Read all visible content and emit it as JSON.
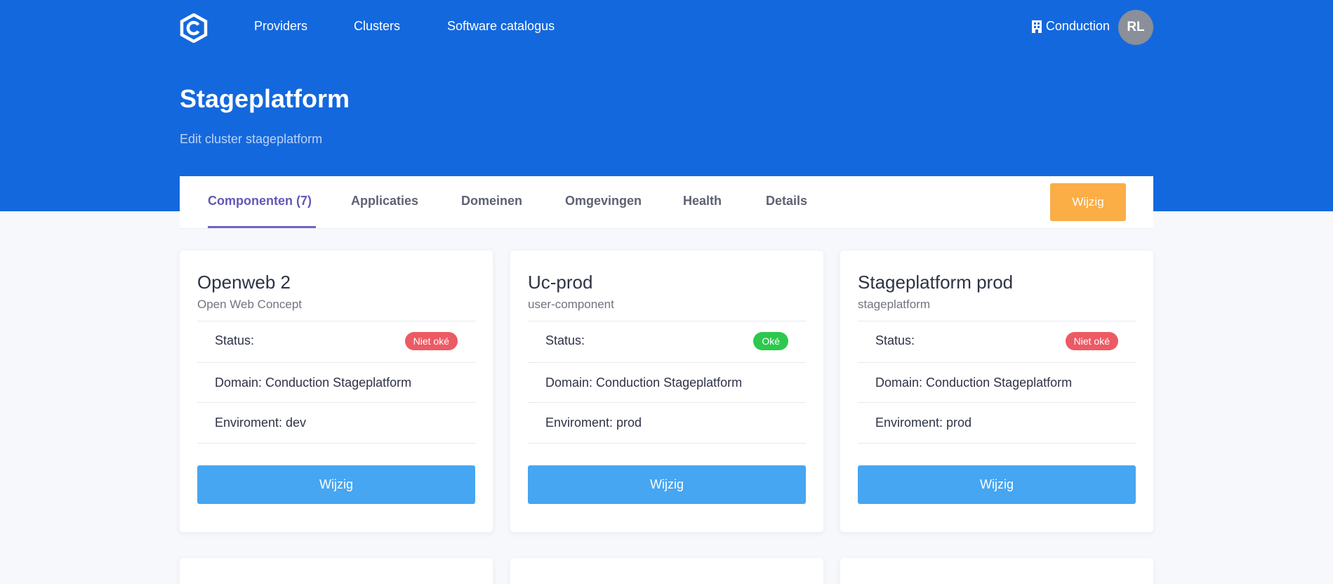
{
  "nav": {
    "links": [
      "Providers",
      "Clusters",
      "Software catalogus"
    ],
    "organization": "Conduction",
    "avatar_initials": "RL"
  },
  "header": {
    "title": "Stageplatform",
    "subtitle": "Edit cluster stageplatform"
  },
  "tabs": [
    "Componenten  (7)",
    "Applicaties",
    "Domeinen",
    "Omgevingen",
    "Health",
    "Details"
  ],
  "edit_button": "Wijzig",
  "cards": [
    {
      "title": "Openweb 2",
      "subtitle": "Open Web Concept",
      "status_label": "Status:",
      "status": "Niet oké",
      "status_ok": false,
      "domain": "Domain: Conduction Stageplatform",
      "environment": "Enviroment: dev",
      "button": "Wijzig"
    },
    {
      "title": "Uc-prod",
      "subtitle": "user-component",
      "status_label": "Status:",
      "status": "Oké",
      "status_ok": true,
      "domain": "Domain: Conduction Stageplatform",
      "environment": "Enviroment: prod",
      "button": "Wijzig"
    },
    {
      "title": "Stageplatform prod",
      "subtitle": "stageplatform",
      "status_label": "Status:",
      "status": "Niet oké",
      "status_ok": false,
      "domain": "Domain: Conduction Stageplatform",
      "environment": "Enviroment: prod",
      "button": "Wijzig"
    }
  ],
  "colors": {
    "header_blue": "#1468dd",
    "accent_orange": "#fbad46",
    "button_blue": "#46a6f2",
    "status_bad": "#ec5a64",
    "status_ok": "#2dc84d",
    "active_tab": "#6158b8"
  }
}
